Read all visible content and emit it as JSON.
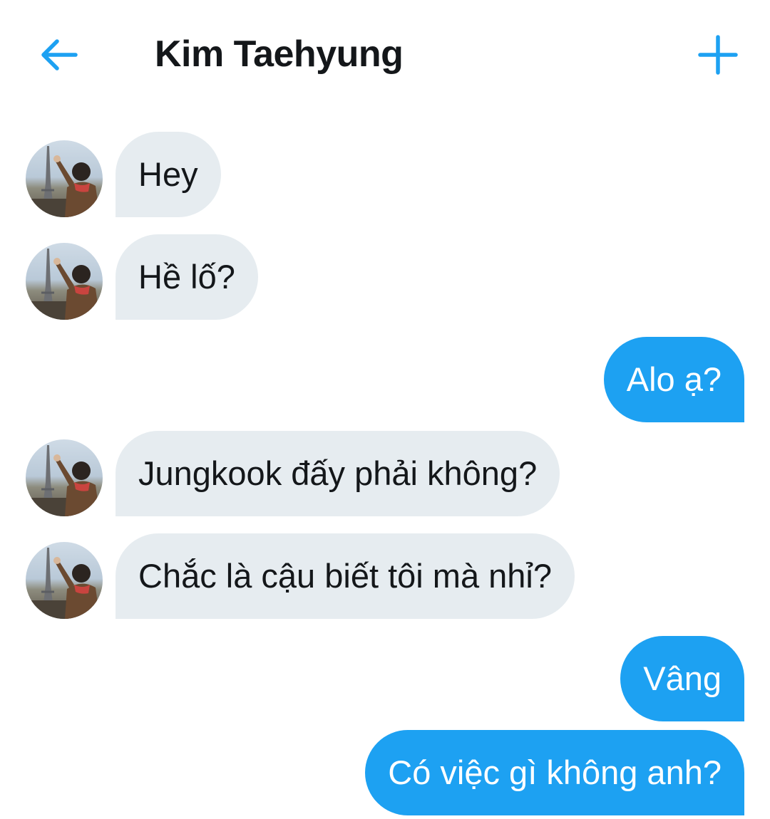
{
  "header": {
    "title": "Kim Taehyung",
    "back_icon": "arrow-left-icon",
    "plus_icon": "plus-icon",
    "accent_color": "#1da1f2"
  },
  "conversation": {
    "messages": [
      {
        "direction": "incoming",
        "text": "Hey"
      },
      {
        "direction": "incoming",
        "text": "Hề lố?"
      },
      {
        "direction": "outgoing",
        "text": "Alo ạ?"
      },
      {
        "direction": "incoming",
        "text": "Jungkook đấy phải không?"
      },
      {
        "direction": "incoming",
        "text": "Chắc là cậu biết tôi mà nhỉ?"
      },
      {
        "direction": "outgoing",
        "text": "Vâng"
      },
      {
        "direction": "outgoing",
        "text": "Có việc gì không anh?"
      }
    ],
    "incoming_bubble_color": "#e6ecf0",
    "outgoing_bubble_color": "#1da1f2"
  }
}
